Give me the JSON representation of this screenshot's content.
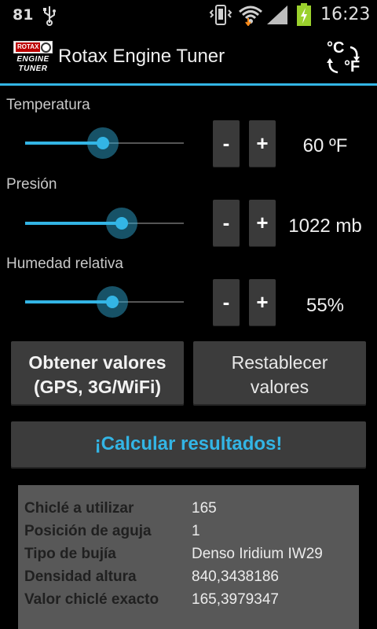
{
  "status_bar": {
    "battery_level": "81",
    "clock": "16:23",
    "icons": [
      "usb-icon",
      "vibrate-icon",
      "wifi-icon",
      "signal-icon",
      "battery-charging-icon"
    ]
  },
  "action_bar": {
    "logo": {
      "brand": "ROTAX",
      "line1": "ENGINE",
      "line2": "TUNER"
    },
    "title": "Rotax Engine Tuner",
    "unit_toggle": {
      "c": "°C",
      "f": "°F"
    }
  },
  "colors": {
    "accent": "#33b5e5",
    "button": "#3c3c3c",
    "results_bg": "#585858"
  },
  "inputs": [
    {
      "label": "Temperatura",
      "value": "60 ºF",
      "slider_level": 0.49,
      "minus": "-",
      "plus": "+"
    },
    {
      "label": "Presión",
      "value": "1022 mb",
      "slider_level": 0.61,
      "minus": "-",
      "plus": "+"
    },
    {
      "label": "Humedad relativa",
      "value": "55%",
      "slider_level": 0.55,
      "minus": "-",
      "plus": "+"
    }
  ],
  "buttons": {
    "gps_line1": "Obtener valores",
    "gps_line2": "(GPS, 3G/WiFi)",
    "reset_line1": "Restablecer",
    "reset_line2": "valores",
    "calculate": "¡Calcular resultados!"
  },
  "results": [
    {
      "key": "Chiclé a utilizar",
      "value": "165"
    },
    {
      "key": "Posición de aguja",
      "value": "1"
    },
    {
      "key": "Tipo de bujía",
      "value": "Denso Iridium IW29"
    },
    {
      "key": "Densidad altura",
      "value": "840,3438186"
    },
    {
      "key": "Valor chiclé exacto",
      "value": "165,3979347"
    }
  ]
}
